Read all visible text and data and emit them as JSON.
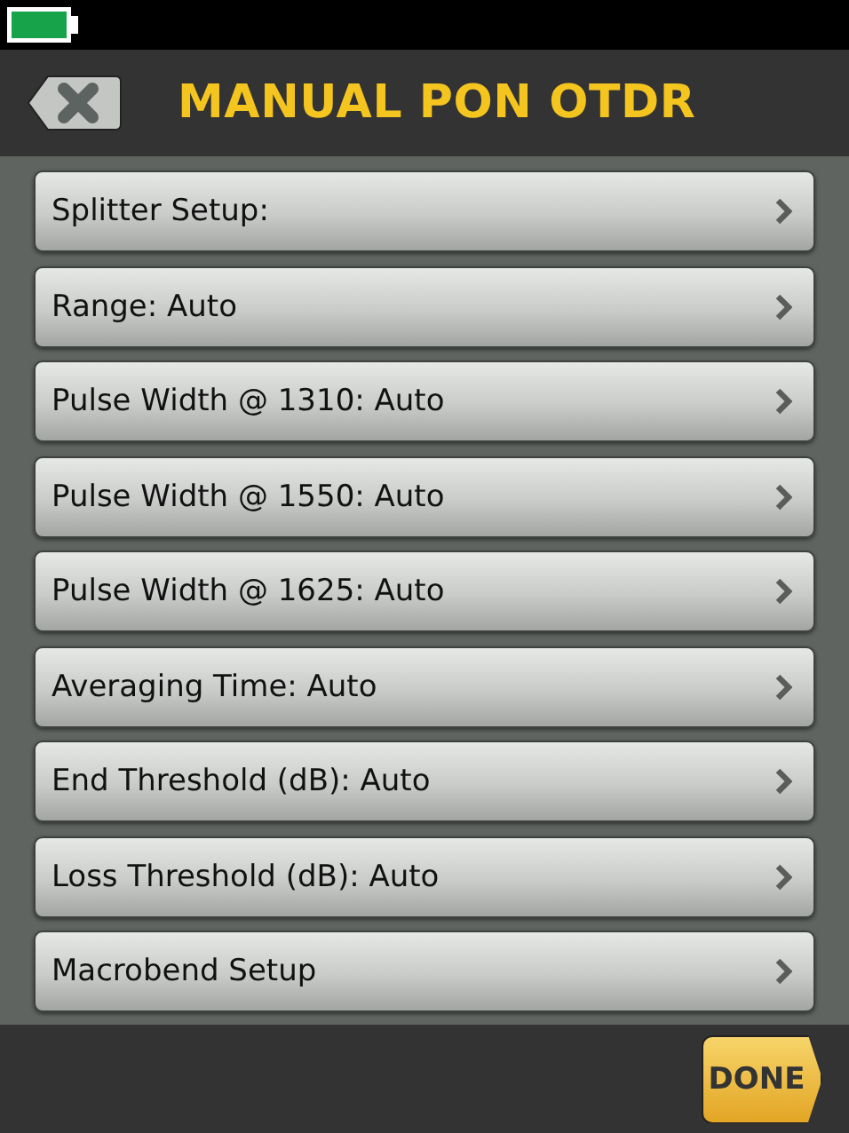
{
  "header": {
    "title": "MANUAL PON OTDR"
  },
  "settings": [
    {
      "label": "Splitter Setup:"
    },
    {
      "label": "Range: Auto"
    },
    {
      "label": "Pulse Width @ 1310: Auto"
    },
    {
      "label": "Pulse Width @ 1550: Auto"
    },
    {
      "label": "Pulse Width @ 1625: Auto"
    },
    {
      "label": "Averaging Time: Auto"
    },
    {
      "label": "End Threshold (dB): Auto"
    },
    {
      "label": "Loss Threshold (dB): Auto"
    },
    {
      "label": "Macrobend Setup"
    }
  ],
  "footer": {
    "done_button": "DONE"
  }
}
